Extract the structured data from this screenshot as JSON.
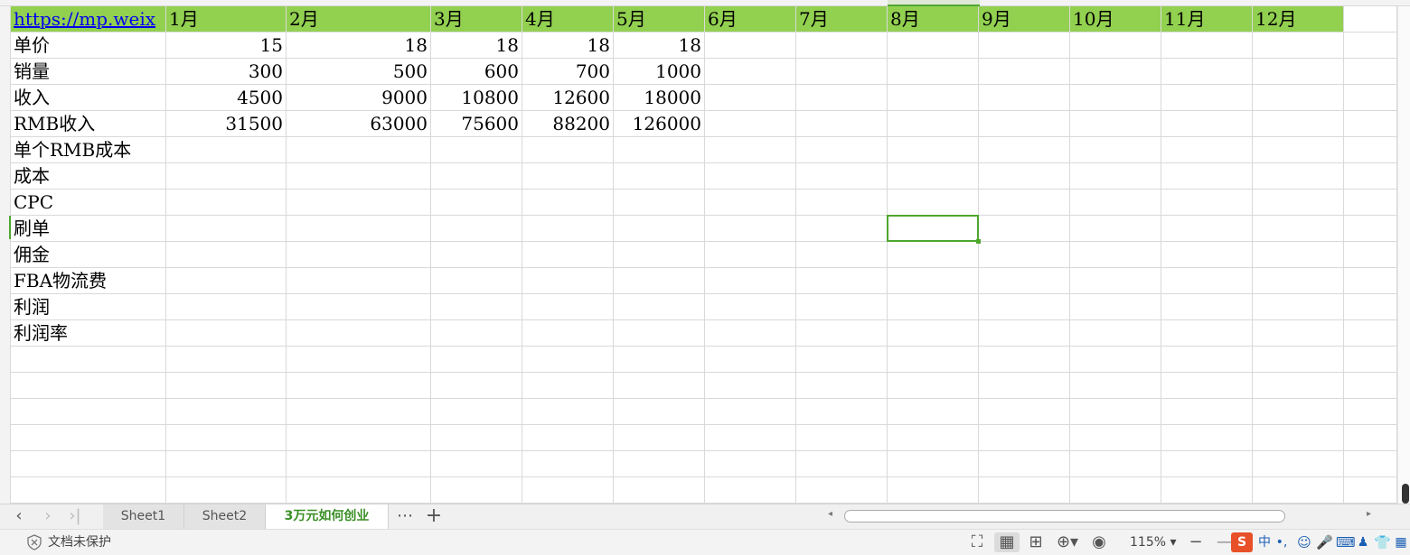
{
  "sheet": {
    "columns": [
      {
        "w": 172,
        "header": "https://mp.weix",
        "link": true
      },
      {
        "w": 133,
        "header": "1月"
      },
      {
        "w": 160,
        "header": "2月"
      },
      {
        "w": 101,
        "header": "3月"
      },
      {
        "w": 101,
        "header": "4月"
      },
      {
        "w": 101,
        "header": "5月"
      },
      {
        "w": 101,
        "header": "6月"
      },
      {
        "w": 101,
        "header": "7月"
      },
      {
        "w": 101,
        "header": "8月"
      },
      {
        "w": 101,
        "header": "9月"
      },
      {
        "w": 101,
        "header": "10月"
      },
      {
        "w": 101,
        "header": "11月"
      },
      {
        "w": 101,
        "header": "12月"
      },
      {
        "w": 59,
        "header": ""
      }
    ],
    "rows": [
      {
        "label": "单价",
        "values": [
          "15",
          "18",
          "18",
          "18",
          "18"
        ]
      },
      {
        "label": "销量",
        "values": [
          "300",
          "500",
          "600",
          "700",
          "1000"
        ]
      },
      {
        "label": "收入",
        "values": [
          "4500",
          "9000",
          "10800",
          "12600",
          "18000"
        ]
      },
      {
        "label": "RMB收入",
        "values": [
          "31500",
          "63000",
          "75600",
          "88200",
          "126000"
        ]
      },
      {
        "label": "单个RMB成本",
        "values": []
      },
      {
        "label": "成本",
        "values": []
      },
      {
        "label": "CPC",
        "values": []
      },
      {
        "label": "刷单",
        "values": []
      },
      {
        "label": "佣金",
        "values": []
      },
      {
        "label": "FBA物流费",
        "values": []
      },
      {
        "label": "利润",
        "values": []
      },
      {
        "label": "利润率",
        "values": []
      }
    ],
    "empty_rows": 6,
    "selected_cell": {
      "col": 8,
      "row": 8
    },
    "header_color": "#92d050",
    "selection_color": "#4ea72e"
  },
  "tabs": [
    {
      "label": "Sheet1",
      "active": false
    },
    {
      "label": "Sheet2",
      "active": false
    },
    {
      "label": "3万元如何创业",
      "active": true
    }
  ],
  "tabbar": {
    "more": "⋯",
    "add": "+"
  },
  "status": {
    "protect_text": "文档未保护",
    "zoom": "115%",
    "icons": [
      "fullscreen-icon",
      "normal-view-icon",
      "page-break-view-icon",
      "reading-layout-icon",
      "eye-protection-icon"
    ]
  }
}
